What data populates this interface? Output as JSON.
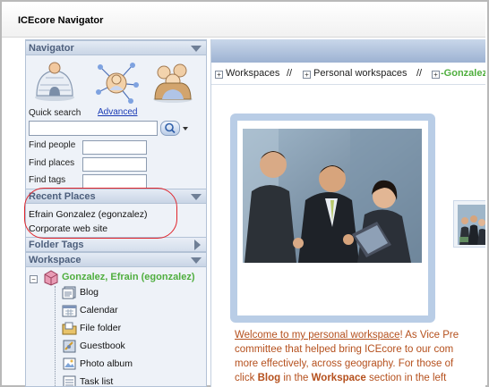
{
  "window": {
    "title": "ICEcore Navigator"
  },
  "sidebar": {
    "navigator": {
      "label": "Navigator"
    },
    "quick_search": {
      "label": "Quick search",
      "advanced_link": "Advanced",
      "value": ""
    },
    "find": [
      {
        "label": "Find people",
        "value": ""
      },
      {
        "label": "Find places",
        "value": ""
      },
      {
        "label": "Find tags",
        "value": ""
      }
    ],
    "recent_places": {
      "label": "Recent Places",
      "items": [
        {
          "label": "Efrain Gonzalez (egonzalez)"
        },
        {
          "label": "Corporate web site"
        }
      ]
    },
    "folder_tags": {
      "label": "Folder Tags"
    },
    "workspace": {
      "label": "Workspace",
      "root": {
        "label": "Gonzalez, Efrain (egonzalez)"
      },
      "items": [
        {
          "label": "Blog",
          "icon": "blog-icon"
        },
        {
          "label": "Calendar",
          "icon": "calendar-icon"
        },
        {
          "label": "File folder",
          "icon": "file-folder-icon"
        },
        {
          "label": "Guestbook",
          "icon": "guestbook-icon"
        },
        {
          "label": "Photo album",
          "icon": "photo-album-icon"
        },
        {
          "label": "Task list",
          "icon": "task-list-icon"
        }
      ]
    }
  },
  "breadcrumb": {
    "items": [
      "Workspaces",
      "Personal workspaces",
      "Gonzalez"
    ],
    "separator": "//"
  },
  "content": {
    "intro_lines": [
      {
        "parts": [
          {
            "t": "Welcome to my personal workspace",
            "style": "link"
          },
          {
            "t": "! As Vice Pre",
            "style": ""
          }
        ]
      },
      {
        "parts": [
          {
            "t": "committee that helped bring ICEcore to our com",
            "style": ""
          }
        ]
      },
      {
        "parts": [
          {
            "t": "more effectively, across geography. For those of",
            "style": ""
          }
        ]
      },
      {
        "parts": [
          {
            "t": "click ",
            "style": ""
          },
          {
            "t": "Blog",
            "style": "bold"
          },
          {
            "t": " in the ",
            "style": ""
          },
          {
            "t": "Workspace",
            "style": "bold"
          },
          {
            "t": " section in the left",
            "style": ""
          }
        ]
      }
    ]
  },
  "colors": {
    "accent_green": "#4fae3e",
    "intro_text": "#b5501d",
    "highlight_red": "#e0242b",
    "panel_header": "#c9d5e6"
  }
}
